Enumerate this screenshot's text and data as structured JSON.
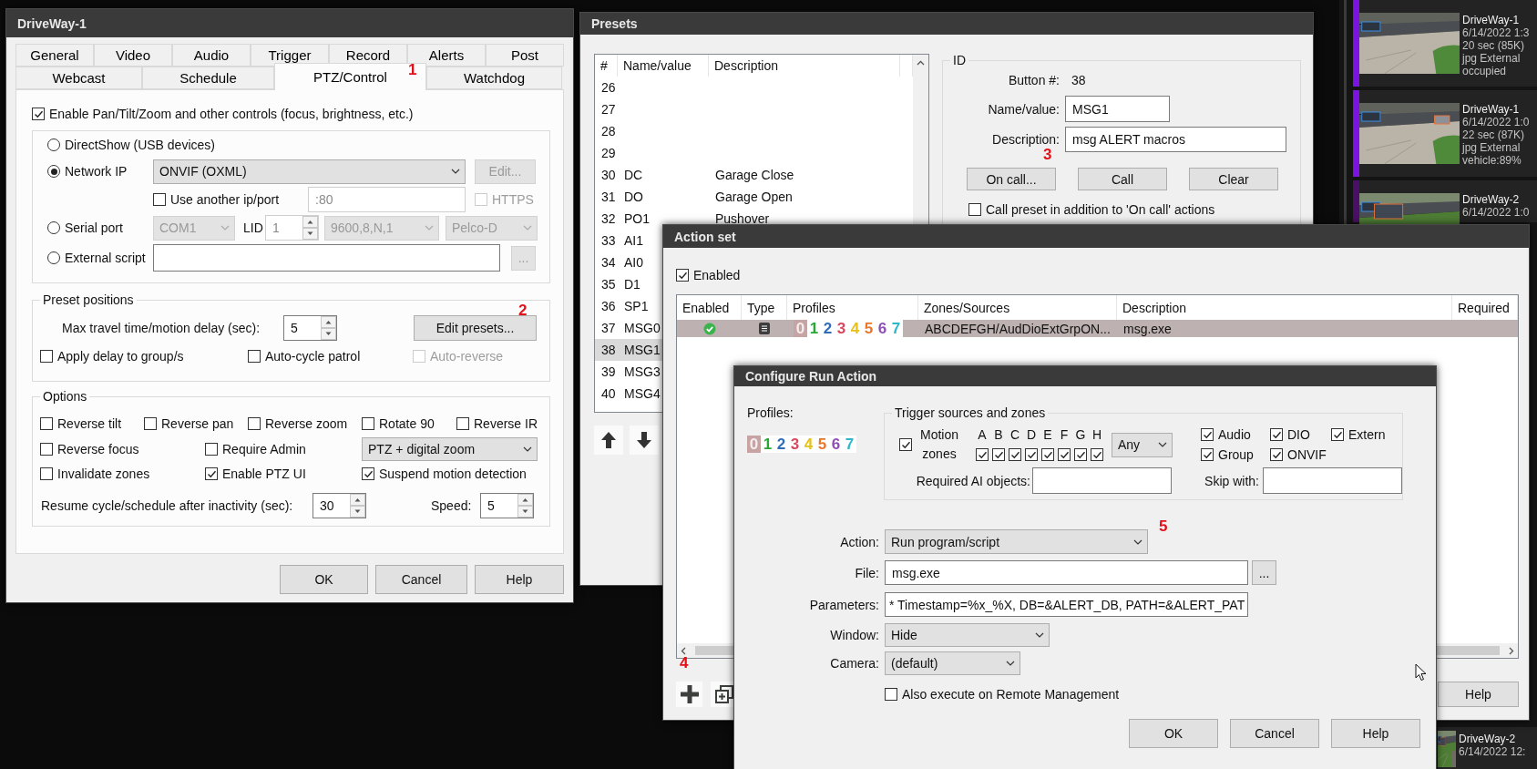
{
  "right_strip": {
    "clips": [
      {
        "title": "DriveWay-1",
        "lines": [
          "6/14/2022 1:3",
          "20 sec (85K)",
          "jpg External",
          "occupied"
        ],
        "color": "#7b14e0"
      },
      {
        "title": "DriveWay-1",
        "lines": [
          "6/14/2022 1:0",
          "22 sec (87K)",
          "jpg External",
          "vehicle:89%"
        ],
        "color": "#7b14e0"
      },
      {
        "title": "DriveWay-2",
        "lines": [
          "6/14/2022 1:0"
        ],
        "color": "#4a0f66"
      }
    ],
    "bottom_clip": {
      "title": "DriveWay-2",
      "lines": [
        "6/14/2022 12:"
      ]
    }
  },
  "main_dialog": {
    "title": "DriveWay-1",
    "tab_rows": [
      [
        {
          "label": "General",
          "selected": false
        },
        {
          "label": "Video",
          "selected": false
        },
        {
          "label": "Audio",
          "selected": false
        },
        {
          "label": "Trigger",
          "selected": false
        },
        {
          "label": "Record",
          "selected": false
        },
        {
          "label": "Alerts",
          "selected": false
        },
        {
          "label": "Post",
          "selected": false
        }
      ],
      [
        {
          "label": "Webcast",
          "selected": false
        },
        {
          "label": "Schedule",
          "selected": false
        },
        {
          "label": "PTZ/Control",
          "selected": true
        },
        {
          "label": "Watchdog",
          "selected": false
        }
      ]
    ],
    "annotation": "1",
    "enable_ptz": {
      "label": "Enable Pan/Tilt/Zoom and other controls (focus, brightness, etc.)",
      "checked": true
    },
    "directshow": {
      "label": "DirectShow (USB devices)",
      "selected": false
    },
    "network": {
      "label": "Network IP",
      "selected": true,
      "protocol": "ONVIF (OXML)",
      "edit_button": {
        "label": "Edit...",
        "disabled": true
      },
      "use_another": {
        "label": "Use another ip/port",
        "checked": false
      },
      "port": {
        "value": ":80",
        "disabled": true
      },
      "https": {
        "label": "HTTPS",
        "checked": false,
        "disabled": true
      }
    },
    "serial": {
      "label": "Serial port",
      "selected": false,
      "port": {
        "value": "COM1",
        "disabled": true
      },
      "lid_label": "LID",
      "lid": {
        "value": "1",
        "disabled": true
      },
      "baud": {
        "value": "9600,8,N,1",
        "disabled": true
      },
      "protocol": {
        "value": "Pelco-D",
        "disabled": true
      }
    },
    "external": {
      "label": "External script",
      "selected": false,
      "browse_button": {
        "label": "...",
        "disabled": true
      }
    },
    "presets": {
      "title": "Preset positions",
      "annotation": "2",
      "delay_label": "Max travel time/motion delay (sec):",
      "delay": "5",
      "edit_button": "Edit presets...",
      "checks": [
        {
          "label": "Apply delay to group/s",
          "checked": false,
          "disabled": false
        },
        {
          "label": "Auto-cycle patrol",
          "checked": false,
          "disabled": false
        },
        {
          "label": "Auto-reverse",
          "checked": false,
          "disabled": true
        }
      ]
    },
    "options": {
      "title": "Options",
      "row_1": [
        {
          "label": "Reverse tilt",
          "checked": false
        },
        {
          "label": "Reverse pan",
          "checked": false
        },
        {
          "label": "Reverse zoom",
          "checked": false
        },
        {
          "label": "Rotate 90",
          "checked": false
        },
        {
          "label": "Reverse IR",
          "checked": false
        }
      ],
      "row_2": [
        {
          "label": "Reverse focus",
          "checked": false
        },
        {
          "label": "Require Admin",
          "checked": false
        }
      ],
      "zoom_mode": "PTZ + digital zoom",
      "row_3": [
        {
          "label": "Invalidate zones",
          "checked": false
        },
        {
          "label": "Enable PTZ UI",
          "checked": true
        },
        {
          "label": "Suspend motion detection",
          "checked": true
        }
      ],
      "resume_label": "Resume cycle/schedule after inactivity (sec):",
      "resume": "30",
      "speed_label": "Speed:",
      "speed": "5"
    },
    "buttons": [
      "OK",
      "Cancel",
      "Help"
    ]
  },
  "presets_window": {
    "title": "Presets",
    "columns": [
      "#",
      "Name/value",
      "Description"
    ],
    "rows": [
      {
        "number": "26",
        "selected": false
      },
      {
        "number": "27",
        "selected": false
      },
      {
        "number": "28",
        "selected": false
      },
      {
        "number": "29",
        "selected": false
      },
      {
        "number": "30",
        "name": "DC",
        "description": "Garage Close",
        "selected": false
      },
      {
        "number": "31",
        "name": "DO",
        "description": "Garage Open",
        "selected": false
      },
      {
        "number": "32",
        "name": "PO1",
        "description": "Pushover",
        "selected": false
      },
      {
        "number": "33",
        "name": "AI1",
        "selected": false
      },
      {
        "number": "34",
        "name": "AI0",
        "selected": false
      },
      {
        "number": "35",
        "name": "D1",
        "selected": false
      },
      {
        "number": "36",
        "name": "SP1",
        "selected": false
      },
      {
        "number": "37",
        "name": "MSG0",
        "selected": false
      },
      {
        "number": "38",
        "name": "MSG1",
        "selected": true
      },
      {
        "number": "39",
        "name": "MSG3",
        "selected": false
      },
      {
        "number": "40",
        "name": "MSG4",
        "selected": false
      }
    ],
    "id_group": {
      "title": "ID",
      "button_label": "Button #:",
      "button_number": "38",
      "name_label": "Name/value:",
      "name": "MSG1",
      "description_label": "Description:",
      "description": "msg ALERT macros",
      "annotation": "3",
      "buttons": [
        "On call...",
        "Call",
        "Clear"
      ],
      "call_preset": {
        "label": "Call preset in addition to 'On call' actions",
        "checked": false
      }
    }
  },
  "action_set": {
    "title": "Action set",
    "enabled": {
      "label": "Enabled",
      "checked": true
    },
    "columns": [
      "Enabled",
      "Type",
      "Profiles",
      "Zones/Sources",
      "Description",
      "Required"
    ],
    "rows": [
      {
        "enabled": true,
        "profiles": [
          {
            "label": "0",
            "color": "#c7a3a3",
            "on": false
          },
          {
            "label": "1",
            "color": "#27a836",
            "on": true
          },
          {
            "label": "2",
            "color": "#2f6cb8",
            "on": true
          },
          {
            "label": "3",
            "color": "#d9485f",
            "on": true
          },
          {
            "label": "4",
            "color": "#e6c219",
            "on": true
          },
          {
            "label": "5",
            "color": "#e8772a",
            "on": true
          },
          {
            "label": "6",
            "color": "#8e4fb5",
            "on": true
          },
          {
            "label": "7",
            "color": "#2bb9c9",
            "on": true
          }
        ],
        "zones": "ABCDEFGH/AudDioExtGrpON...",
        "description": "msg.exe",
        "selected": true
      }
    ],
    "annotation": "4",
    "help_button": "Help"
  },
  "configure_action": {
    "title": "Configure Run Action",
    "profiles_label": "Profiles:",
    "profiles": [
      {
        "label": "0",
        "color": "#c7a3a3",
        "on": false
      },
      {
        "label": "1",
        "color": "#27a836",
        "on": true
      },
      {
        "label": "2",
        "color": "#2f6cb8",
        "on": true
      },
      {
        "label": "3",
        "color": "#d9485f",
        "on": true
      },
      {
        "label": "4",
        "color": "#e6c219",
        "on": true
      },
      {
        "label": "5",
        "color": "#e8772a",
        "on": true
      },
      {
        "label": "6",
        "color": "#8e4fb5",
        "on": true
      },
      {
        "label": "7",
        "color": "#2bb9c9",
        "on": true
      }
    ],
    "trigger_group": {
      "title": "Trigger sources and zones",
      "motion": {
        "label": "Motion zones",
        "checked": true
      },
      "zones": [
        {
          "letter": "A",
          "checked": true
        },
        {
          "letter": "B",
          "checked": true
        },
        {
          "letter": "C",
          "checked": true
        },
        {
          "letter": "D",
          "checked": true
        },
        {
          "letter": "E",
          "checked": true
        },
        {
          "letter": "F",
          "checked": true
        },
        {
          "letter": "G",
          "checked": true
        },
        {
          "letter": "H",
          "checked": true
        }
      ],
      "zone_mode": "Any",
      "sources": [
        {
          "label": "Audio",
          "checked": true
        },
        {
          "label": "DIO",
          "checked": true
        },
        {
          "label": "Extern",
          "checked": true
        },
        {
          "label": "Group",
          "checked": true
        },
        {
          "label": "ONVIF",
          "checked": true
        }
      ],
      "ai_label": "Required AI objects:",
      "skip_label": "Skip with:"
    },
    "annotation": "5",
    "action_label": "Action:",
    "action": "Run program/script",
    "file_label": "File:",
    "file": "msg.exe",
    "browse_button": "...",
    "parameters_label": "Parameters:",
    "parameters": "* Timestamp=%x_%X, DB=&ALERT_DB, PATH=&ALERT_PAT",
    "window_label": "Window:",
    "window": "Hide",
    "camera_label": "Camera:",
    "camera": "(default)",
    "remote": {
      "label": "Also execute on Remote Management",
      "checked": false
    },
    "buttons": [
      "OK",
      "Cancel",
      "Help"
    ]
  }
}
